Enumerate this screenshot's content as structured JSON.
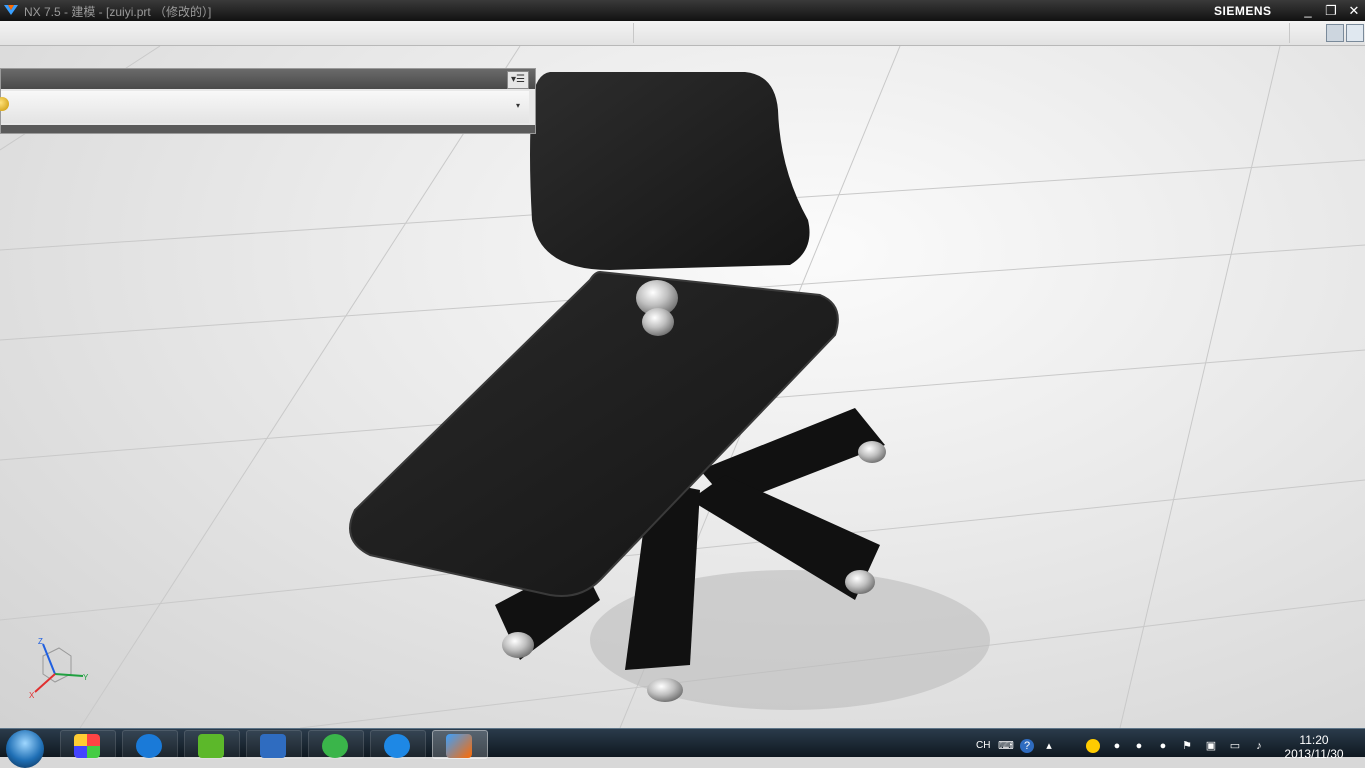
{
  "window": {
    "title": "NX 7.5 - 建模 - [zuiyi.prt （修改的）]",
    "brand": "SIEMENS",
    "minimize": "_",
    "restore": "❐",
    "close": "✕"
  },
  "panel": {
    "menu_label": "▾☰",
    "combo_arrow": "▾"
  },
  "triad": {
    "x": "X",
    "y": "Y",
    "z": "Z"
  },
  "taskbar": {
    "language": "CH",
    "help": "?",
    "time": "11:20",
    "date": "2013/11/30"
  },
  "colors": {
    "seat": "#1c1c1c",
    "caster": "#c8c8c8",
    "floor": "#e6e6e6"
  }
}
